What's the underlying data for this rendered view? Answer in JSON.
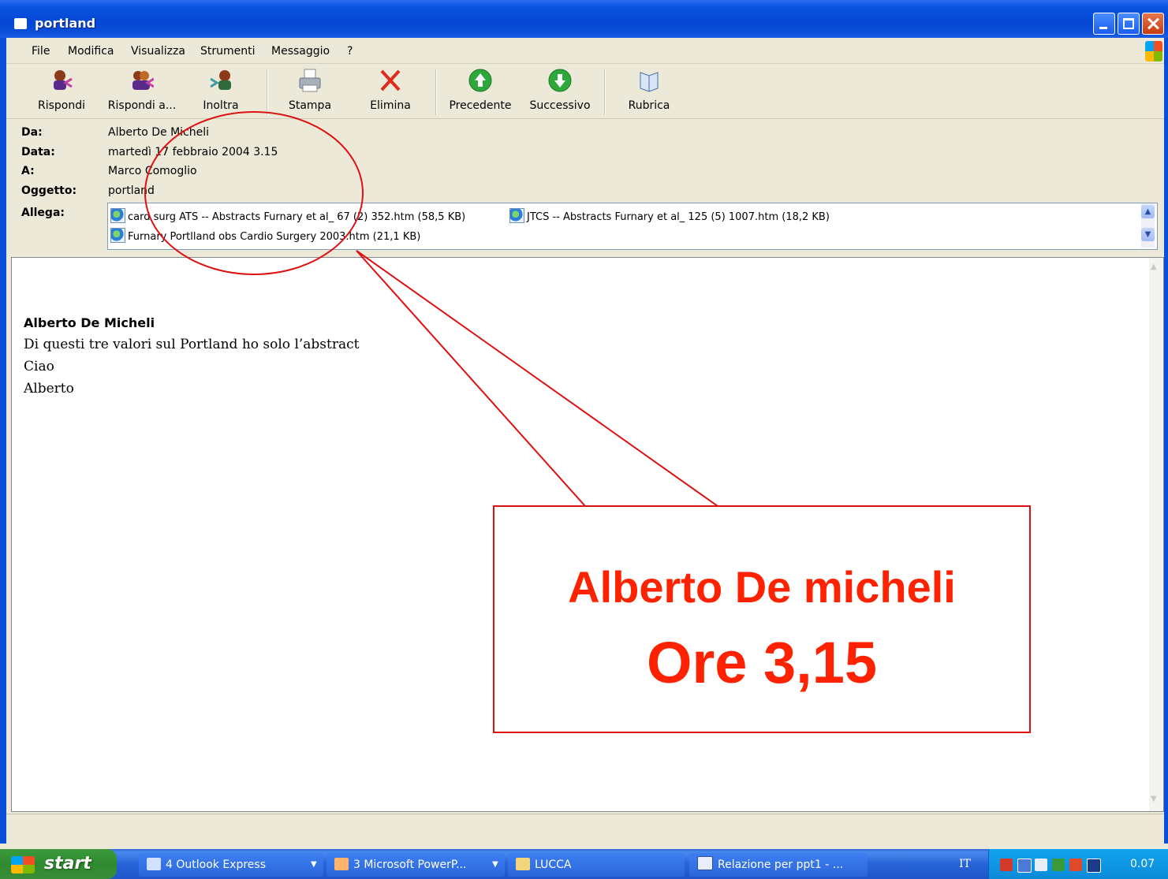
{
  "window": {
    "title": "portland"
  },
  "menu": [
    "File",
    "Modifica",
    "Visualizza",
    "Strumenti",
    "Messaggio",
    "?"
  ],
  "toolbar": {
    "reply": "Rispondi",
    "reply_all": "Rispondi a...",
    "forward": "Inoltra",
    "print": "Stampa",
    "delete": "Elimina",
    "previous": "Precedente",
    "next": "Successivo",
    "addressbook": "Rubrica"
  },
  "header": {
    "from_label": "Da:",
    "from": "Alberto De Micheli",
    "date_label": "Data:",
    "date": "martedì 17 febbraio 2004 3.15",
    "to_label": "A:",
    "to": "Marco Comoglio",
    "subject_label": "Oggetto:",
    "subject": "portland",
    "attach_label": "Allega:",
    "attachments": [
      "card surg ATS -- Abstracts Furnary et al_ 67 (2) 352.htm (58,5 KB)",
      "JTCS -- Abstracts Furnary et al_ 125 (5) 1007.htm (18,2 KB)",
      "Furnary Portlland obs Cardio Surgery 2003.htm (21,1 KB)"
    ]
  },
  "body": {
    "sender": "Alberto De Micheli",
    "lines": [
      "Di questi tre valori sul Portland ho solo l’abstract",
      "Ciao",
      "Alberto"
    ]
  },
  "callout": {
    "line1": "Alberto De micheli",
    "line2": "Ore 3,15",
    "color": "#ff2200"
  },
  "taskbar": {
    "start": "start",
    "tasks": [
      "4 Outlook Express",
      "3 Microsoft PowerP...",
      "LUCCA",
      "Relazione per ppt1 - ..."
    ],
    "language": "IT",
    "clock": "0.07"
  }
}
